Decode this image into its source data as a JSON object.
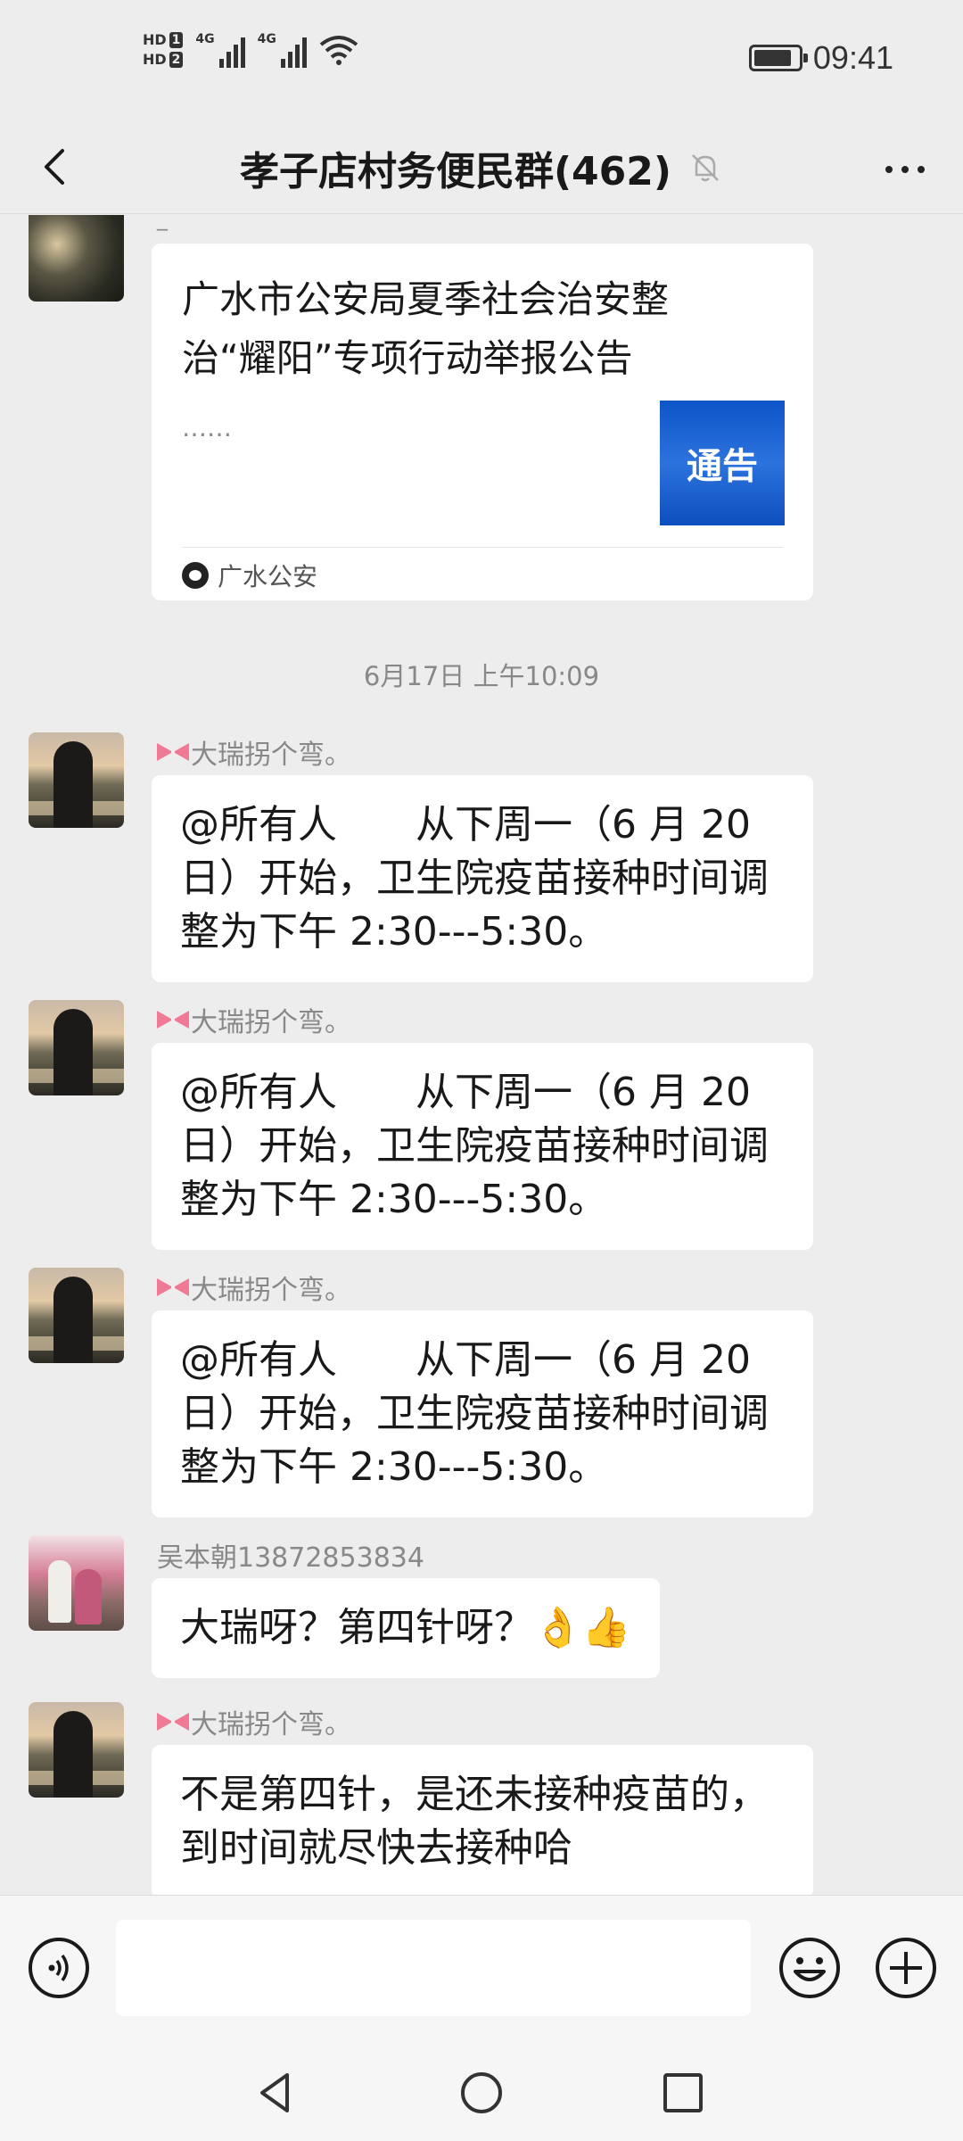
{
  "status_bar": {
    "hd1": "HD",
    "hd1_num": "1",
    "hd2": "HD",
    "hd2_num": "2",
    "signal1": "4G",
    "signal2": "4G",
    "battery_level": 0.85,
    "time": "09:41"
  },
  "header": {
    "title": "孝子店村务便民群(462)",
    "icons": [
      "back-icon",
      "mute-bell-icon",
      "more-icon"
    ]
  },
  "article_card": {
    "sender": "_",
    "title": "广水市公安局夏季社会治安整治“耀阳”专项行动举报公告",
    "description": "……",
    "thumbnail_text": "通告",
    "source": "广水公安"
  },
  "timestamp": "6月17日 上午10:09",
  "messages": [
    {
      "sender": "大瑞拐个弯。",
      "lines": [
        "@所有人　　从下周一（6 月 20",
        "日）开始，卫生院疫苗接种时间调",
        "整为下午 2:30---5:30。"
      ]
    },
    {
      "sender": "大瑞拐个弯。",
      "lines": [
        "@所有人　　从下周一（6 月 20",
        "日）开始，卫生院疫苗接种时间调",
        "整为下午 2:30---5:30。"
      ]
    },
    {
      "sender": "大瑞拐个弯。",
      "lines": [
        "@所有人　　从下周一（6 月 20",
        "日）开始，卫生院疫苗接种时间调",
        "整为下午 2:30---5:30。"
      ]
    },
    {
      "sender": "吴本朝13872853834",
      "lines": [
        "大瑞呀？第四针呀？👌👍"
      ]
    },
    {
      "sender": "大瑞拐个弯。",
      "lines": [
        "不是第四针，是还未接种疫苗的，",
        "到时间就尽快去接种哈"
      ]
    }
  ],
  "input_bar": {
    "placeholder": "",
    "icons": [
      "voice-icon",
      "emoji-icon",
      "plus-icon"
    ]
  },
  "nav_bar": {
    "icons": [
      "nav-back-icon",
      "nav-home-icon",
      "nav-recent-icon"
    ]
  }
}
